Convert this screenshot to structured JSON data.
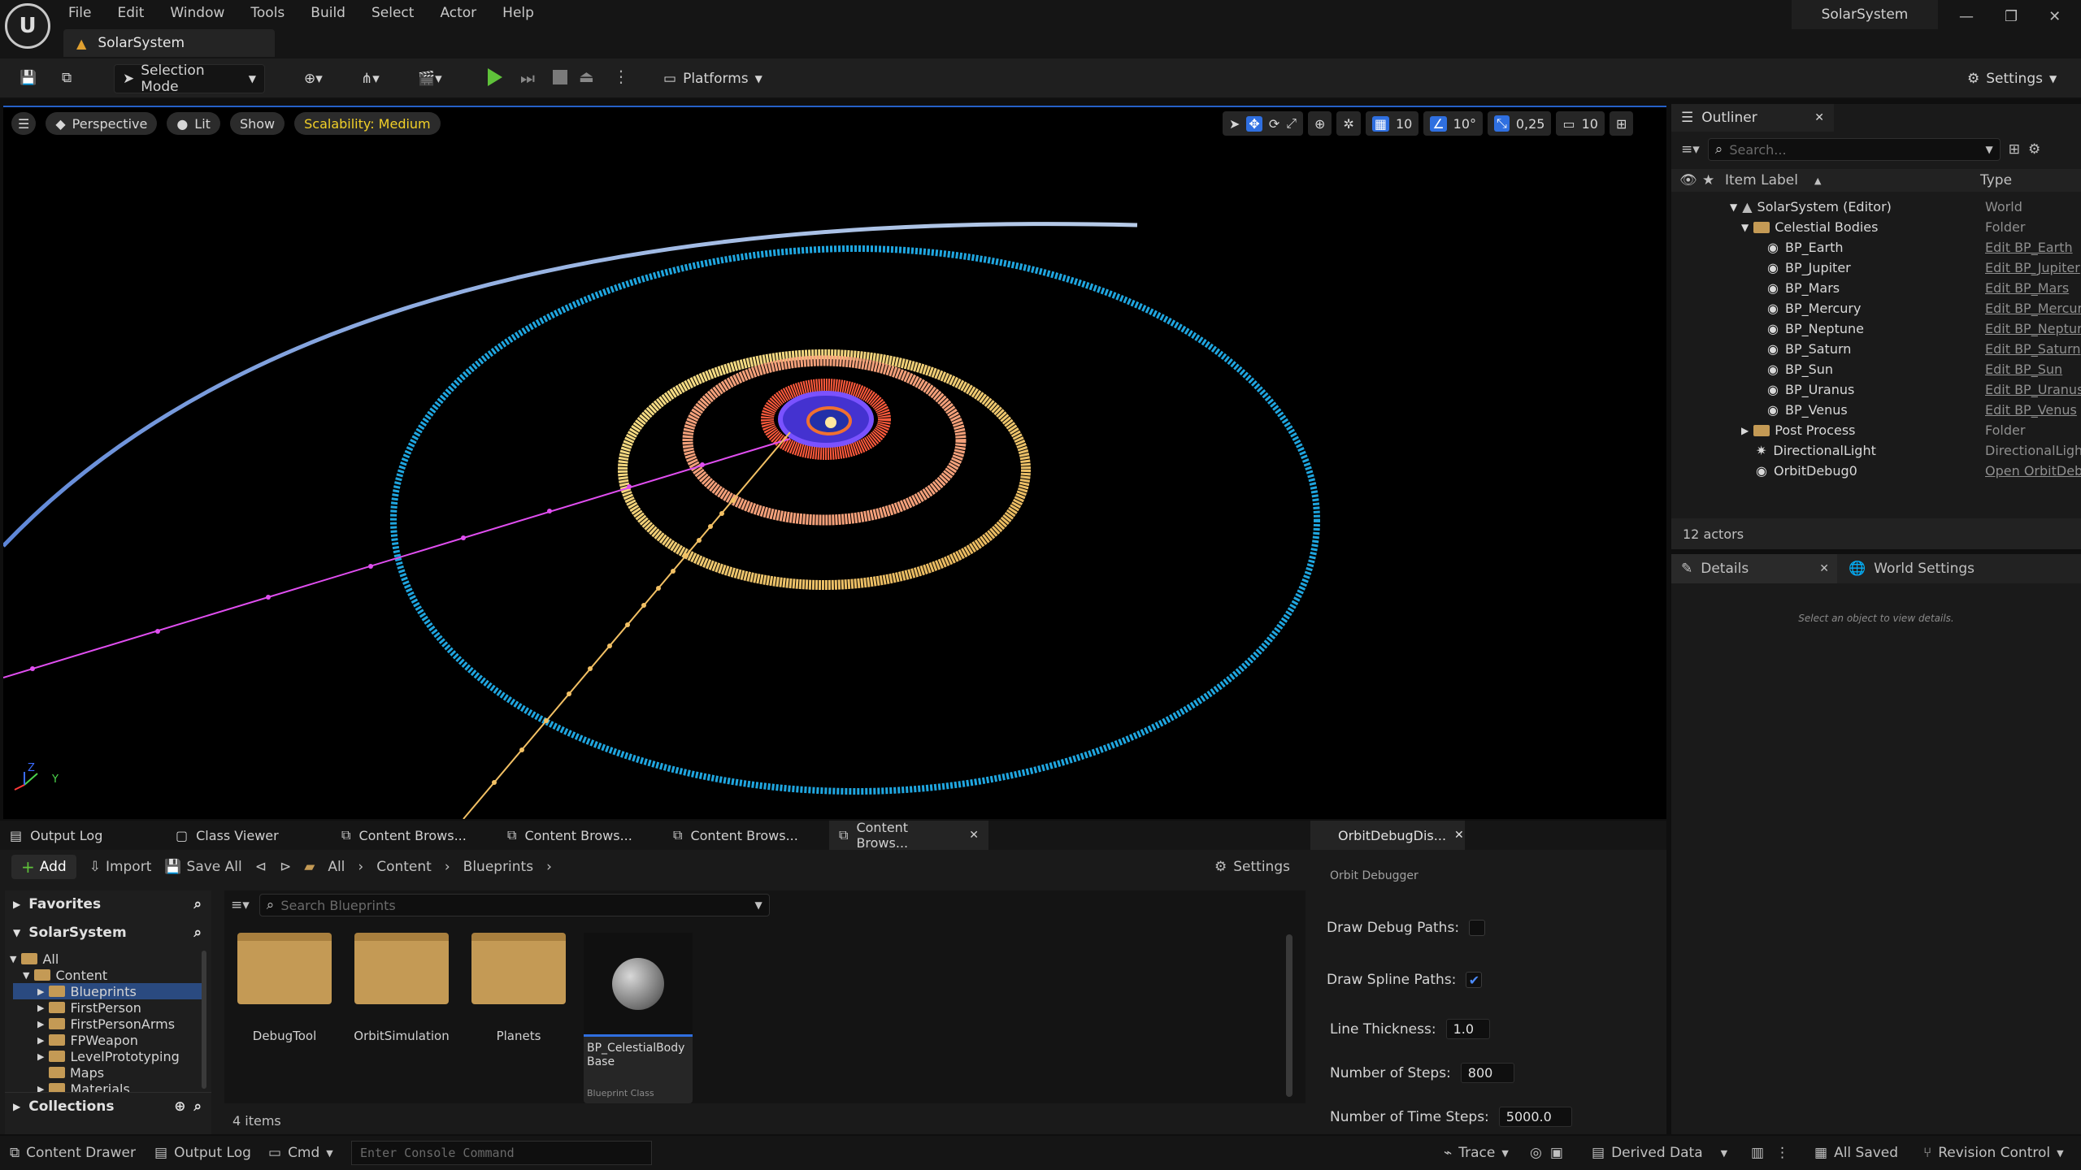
{
  "app": {
    "menu": [
      "File",
      "Edit",
      "Window",
      "Tools",
      "Build",
      "Select",
      "Actor",
      "Help"
    ],
    "document_tab": "SolarSystem",
    "window_title": "SolarSystem"
  },
  "toolbar": {
    "selection_mode": "Selection Mode",
    "platforms": "Platforms",
    "settings": "Settings"
  },
  "viewport": {
    "perspective": "Perspective",
    "lit": "Lit",
    "show": "Show",
    "scalability": "Scalability: Medium",
    "grid_snap": "10",
    "rotation_snap": "10°",
    "scale_snap": "0,25",
    "camera_speed": "10",
    "axis_z": "Z",
    "axis_y": "Y"
  },
  "outliner": {
    "title": "Outliner",
    "search_placeholder": "Search...",
    "col_label": "Item Label",
    "col_type": "Type",
    "rows": [
      {
        "label": "SolarSystem (Editor)",
        "type": "World"
      },
      {
        "label": "Celestial Bodies",
        "type": "Folder"
      },
      {
        "label": "BP_Earth",
        "type": "Edit BP_Earth"
      },
      {
        "label": "BP_Jupiter",
        "type": "Edit BP_Jupiter"
      },
      {
        "label": "BP_Mars",
        "type": "Edit BP_Mars"
      },
      {
        "label": "BP_Mercury",
        "type": "Edit BP_Mercury"
      },
      {
        "label": "BP_Neptune",
        "type": "Edit BP_Neptune"
      },
      {
        "label": "BP_Saturn",
        "type": "Edit BP_Saturn"
      },
      {
        "label": "BP_Sun",
        "type": "Edit BP_Sun"
      },
      {
        "label": "BP_Uranus",
        "type": "Edit BP_Uranus"
      },
      {
        "label": "BP_Venus",
        "type": "Edit BP_Venus"
      },
      {
        "label": "Post Process",
        "type": "Folder"
      },
      {
        "label": "DirectionalLight",
        "type": "DirectionalLight"
      },
      {
        "label": "OrbitDebug0",
        "type": "Open OrbitDebug"
      }
    ],
    "actor_count": "12 actors"
  },
  "details": {
    "tab_details": "Details",
    "tab_world": "World Settings",
    "empty_text": "Select an object to view details."
  },
  "bottom_tabs": [
    "Output Log",
    "Class Viewer",
    "Content Brows...",
    "Content Brows...",
    "Content Brows...",
    "Content Brows..."
  ],
  "content_browser": {
    "add": "Add",
    "import": "Import",
    "save_all": "Save All",
    "path": [
      "All",
      "Content",
      "Blueprints"
    ],
    "settings": "Settings",
    "favorites": "Favorites",
    "project": "SolarSystem",
    "collections": "Collections",
    "search_placeholder": "Search Blueprints",
    "tree": [
      "All",
      "Content",
      "Blueprints",
      "FirstPerson",
      "FirstPersonArms",
      "FPWeapon",
      "LevelPrototyping",
      "Maps",
      "Materials"
    ],
    "items": [
      {
        "name": "DebugTool"
      },
      {
        "name": "OrbitSimulation"
      },
      {
        "name": "Planets"
      },
      {
        "name": "BP_CelestialBody Base",
        "sub": "Blueprint Class"
      }
    ],
    "count": "4 items"
  },
  "orbit_debug": {
    "tab": "OrbitDebugDis...",
    "header": "Orbit Debugger",
    "draw_debug_paths": "Draw Debug Paths:",
    "draw_spline_paths": "Draw Spline Paths:",
    "line_thickness_label": "Line Thickness:",
    "line_thickness": "1.0",
    "steps_label": "Number of Steps:",
    "steps": "800",
    "time_steps_label": "Number of Time Steps:",
    "time_steps": "5000.0"
  },
  "statusbar": {
    "content_drawer": "Content Drawer",
    "output_log": "Output Log",
    "cmd": "Cmd",
    "console_placeholder": "Enter Console Command",
    "trace": "Trace",
    "derived_data": "Derived Data",
    "all_saved": "All Saved",
    "revision_control": "Revision Control"
  }
}
